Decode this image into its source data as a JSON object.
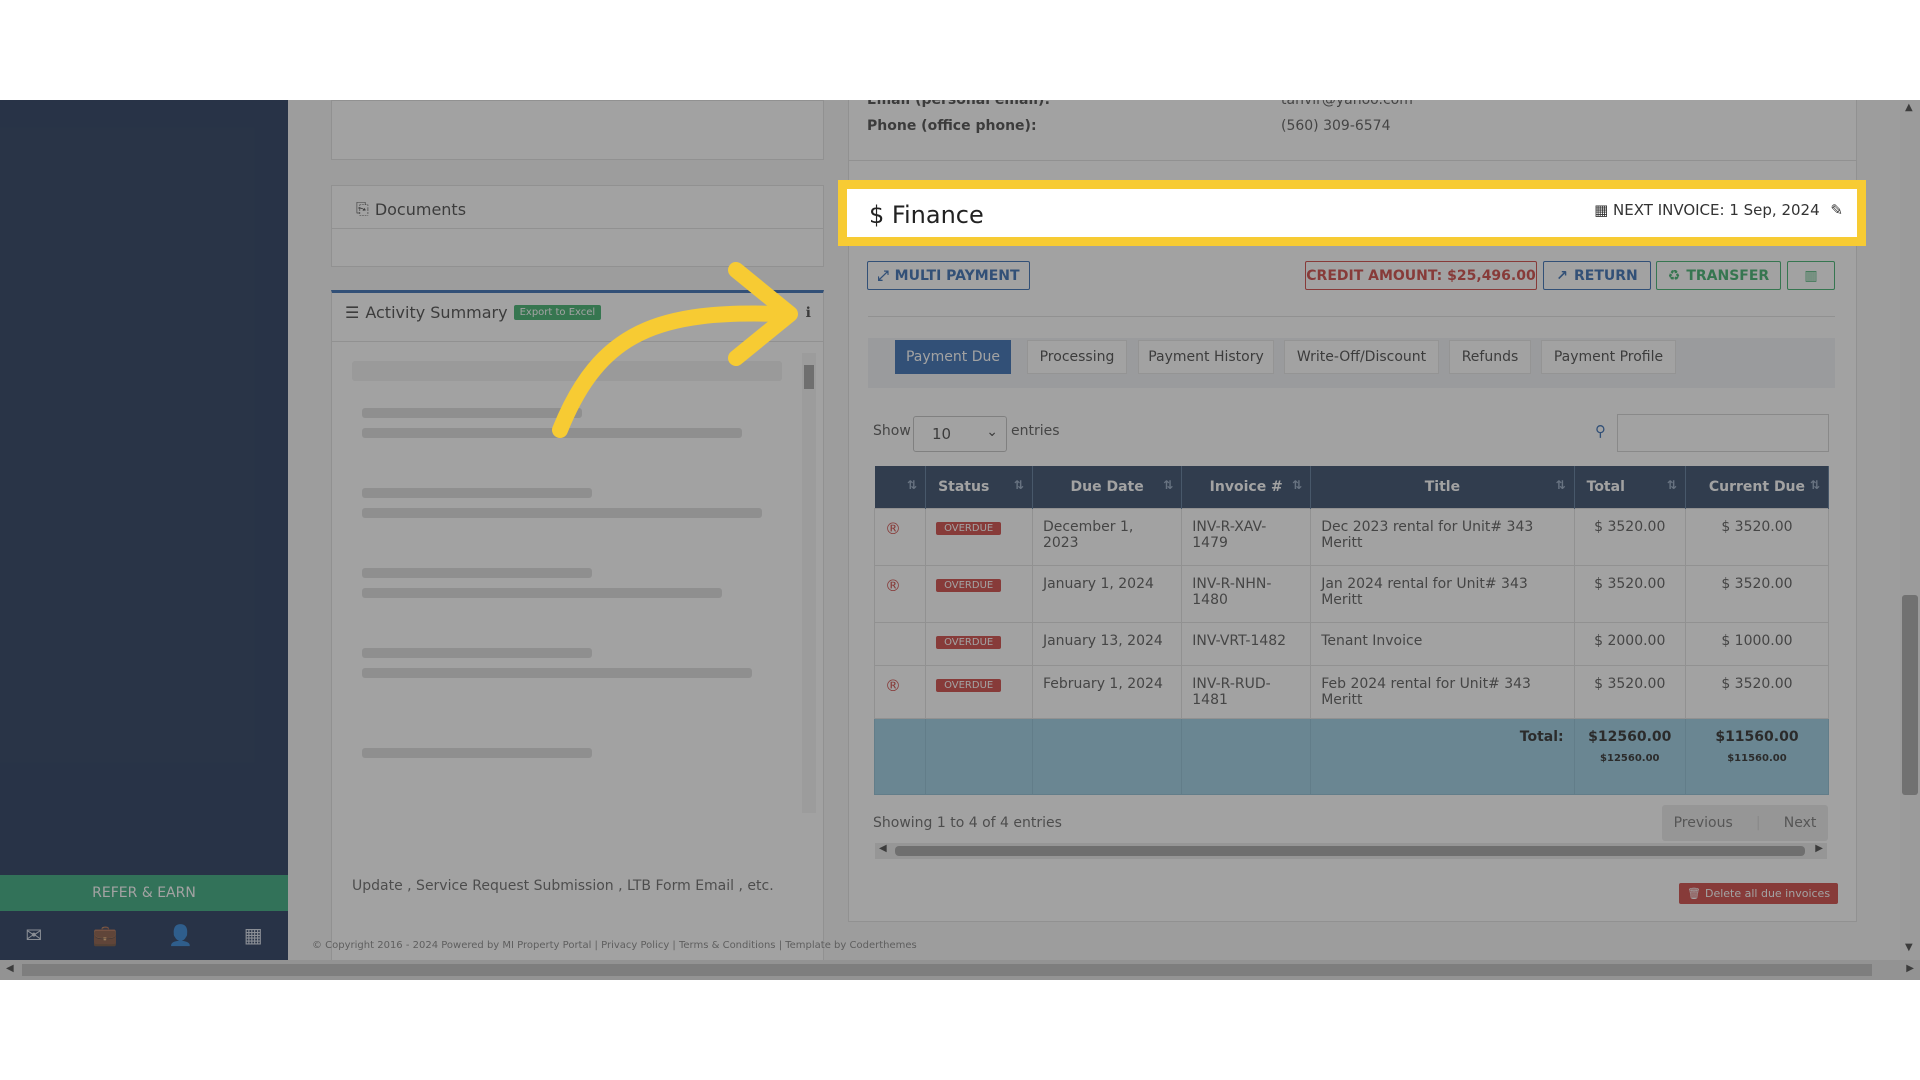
{
  "sidebar": {
    "refer_label": "REFER & EARN",
    "icons": [
      "envelope-icon",
      "briefcase-icon",
      "user-icon",
      "calculator-icon"
    ]
  },
  "left": {
    "documents_label": "Documents",
    "activity_label": "Activity Summary",
    "export_label": "Export to Excel",
    "activity_text": "Update , Service Request Submission , LTB Form Email , etc."
  },
  "contact": {
    "email_label": "Email (personal email):",
    "email_value": "tanvir@yahoo.com",
    "phone_label": "Phone (office phone):",
    "phone_value": "(560) 309-6574"
  },
  "finance": {
    "title": "Finance",
    "next_invoice": "NEXT INVOICE: 1 Sep, 2024"
  },
  "actions": {
    "multi_payment": "MULTI PAYMENT",
    "credit_amount": "CREDIT AMOUNT: $25,496.00",
    "return": "RETURN",
    "transfer": "TRANSFER"
  },
  "tabs": [
    "Payment Due",
    "Processing",
    "Payment History",
    "Write-Off/Discount",
    "Refunds",
    "Payment Profile"
  ],
  "table_controls": {
    "show_label": "Show",
    "entries_value": "10",
    "entries_label": "entries"
  },
  "table": {
    "headers": [
      "",
      "Status",
      "Due Date",
      "Invoice #",
      "Title",
      "Total",
      "Current Due"
    ],
    "rows": [
      {
        "flag": "®",
        "status": "OVERDUE",
        "due": "December 1, 2023",
        "invoice": "INV-R-XAV-1479",
        "title": "Dec 2023 rental for Unit# 343 Meritt",
        "total": "$ 3520.00",
        "current": "$ 3520.00"
      },
      {
        "flag": "®",
        "status": "OVERDUE",
        "due": "January 1, 2024",
        "invoice": "INV-R-NHN-1480",
        "title": "Jan 2024 rental for Unit# 343 Meritt",
        "total": "$ 3520.00",
        "current": "$ 3520.00"
      },
      {
        "flag": "",
        "status": "OVERDUE",
        "due": "January 13, 2024",
        "invoice": "INV-VRT-1482",
        "title": "Tenant Invoice",
        "total": "$ 2000.00",
        "current": "$ 1000.00"
      },
      {
        "flag": "®",
        "status": "OVERDUE",
        "due": "February 1, 2024",
        "invoice": "INV-R-RUD-1481",
        "title": "Feb 2024 rental for Unit# 343 Meritt",
        "total": "$ 3520.00",
        "current": "$ 3520.00"
      }
    ],
    "total_label": "Total:",
    "total_sum": "$12560.00",
    "total_sum_small": "$12560.00",
    "current_sum": "$11560.00",
    "current_sum_small": "$11560.00"
  },
  "pagination": {
    "showing": "Showing 1 to 4 of 4 entries",
    "previous": "Previous",
    "next": "Next"
  },
  "delete_all": "Delete all due invoices",
  "footer": "© Copyright 2016 - 2024 Powered by MI Property Portal | Privacy Policy | Terms & Conditions | Template by Coderthemes",
  "colors": {
    "highlight": "#f7cb33",
    "header_bg": "#1d3557",
    "overdue": "#c9302c",
    "credit": "#c9302c",
    "return": "#1e5aa8",
    "transfer": "#26a65b",
    "total_row": "#8fc6de"
  }
}
